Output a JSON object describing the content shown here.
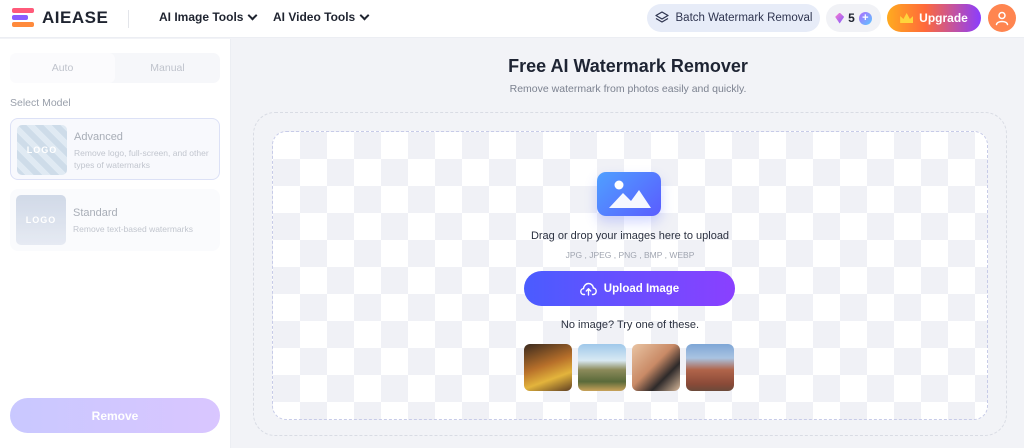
{
  "header": {
    "brand": "AIEASE",
    "nav": [
      {
        "label": "AI Image Tools"
      },
      {
        "label": "AI Video Tools"
      }
    ],
    "batch_label": "Batch Watermark Removal",
    "credits": "5",
    "upgrade_label": "Upgrade"
  },
  "sidebar": {
    "tabs": [
      {
        "label": "Auto",
        "active": true
      },
      {
        "label": "Manual",
        "active": false
      }
    ],
    "section_label": "Select Model",
    "models": [
      {
        "title": "Advanced",
        "description": "Remove logo, full-screen, and other types of watermarks",
        "thumb_text": "LOGO",
        "selected": true
      },
      {
        "title": "Standard",
        "description": "Remove text-based watermarks",
        "thumb_text": "LOGO",
        "selected": false
      }
    ],
    "remove_label": "Remove"
  },
  "main": {
    "title": "Free AI Watermark Remover",
    "subtitle": "Remove watermark from photos easily and quickly.",
    "drop_text": "Drag or drop your images here to upload",
    "formats": "JPG , JPEG , PNG , BMP , WEBP",
    "upload_label": "Upload Image",
    "try_text": "No image? Try one of these."
  },
  "colors": {
    "accent_start": "#4a5cff",
    "accent_end": "#8a40ff",
    "upgrade_start": "#ffab1f",
    "avatar": "#ff8550"
  }
}
